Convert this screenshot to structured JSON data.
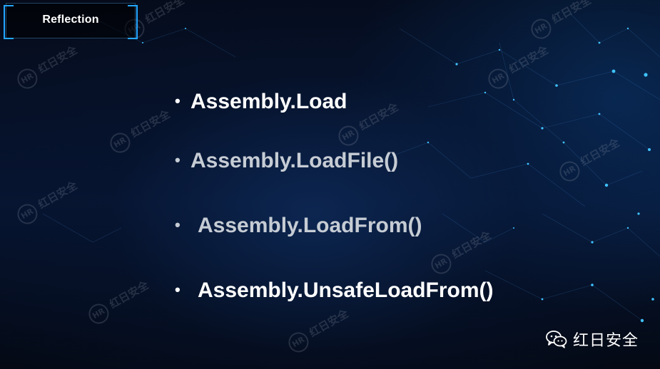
{
  "slide": {
    "title": "Reflection",
    "bullets": [
      {
        "text": "Assembly.Load"
      },
      {
        "text": "Assembly.LoadFile()"
      },
      {
        "text": "Assembly.LoadFrom()"
      },
      {
        "text": "Assembly.UnsafeLoadFrom()"
      }
    ],
    "bullet_glyph": "•"
  },
  "watermark": {
    "text": "红日安全",
    "logo": "HR"
  },
  "brand": {
    "icon": "wechat-icon",
    "name": "红日安全"
  },
  "colors": {
    "background": "#050a18",
    "accent": "#22a6ff",
    "bullet_primary": "#ffffff",
    "bullet_secondary": "#c6ccd4"
  }
}
